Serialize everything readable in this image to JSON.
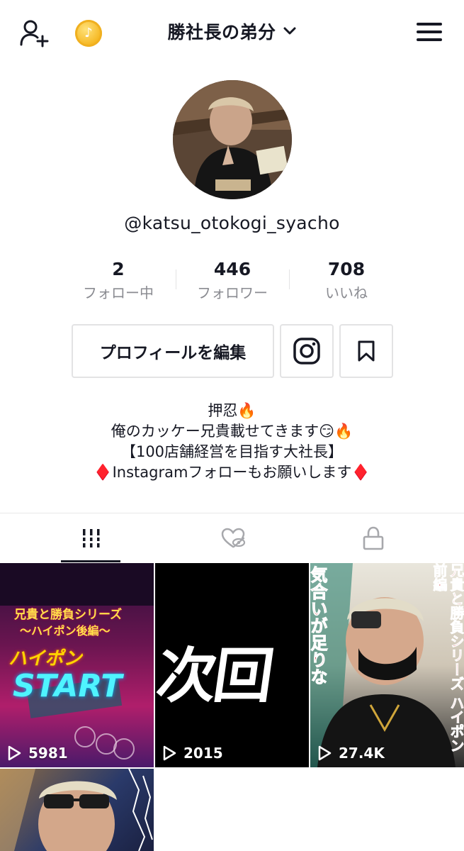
{
  "header": {
    "username_title": "勝社長の弟分"
  },
  "icons": {
    "add_user": "add-user-icon",
    "coin": "tiktok-coin-icon",
    "menu": "hamburger-menu-icon"
  },
  "profile": {
    "handle": "@katsu_otokogi_syacho"
  },
  "stats": [
    {
      "value": "2",
      "label": "フォロー中"
    },
    {
      "value": "446",
      "label": "フォロワー"
    },
    {
      "value": "708",
      "label": "いいね"
    }
  ],
  "actions": {
    "edit_profile_label": "プロフィールを編集"
  },
  "bio": {
    "lines": [
      "押忍🔥",
      "俺のカッケー兄貴載せてきます😏🔥",
      "【100店舗経営を目指す大社長】",
      "♦️Instagramフォローもお願いします♦️"
    ]
  },
  "videos": [
    {
      "views": "5981",
      "overlay_top": "兄貴と勝負シリーズ",
      "overlay_mid": "〜ハイポン後編〜",
      "overlay_a": "ハイポン",
      "overlay_b": "START"
    },
    {
      "views": "2015",
      "overlay_text": "次回"
    },
    {
      "views": "27.4K",
      "overlay_left": "気合いが足りな",
      "overlay_right": "兄貴と勝負シリーズ ハイポン 前編"
    },
    {
      "views": ""
    }
  ],
  "colors": {
    "text_primary": "#161823",
    "text_secondary": "#8a8b91",
    "border": "#e3e3e4",
    "coin": "#f5b51e"
  }
}
